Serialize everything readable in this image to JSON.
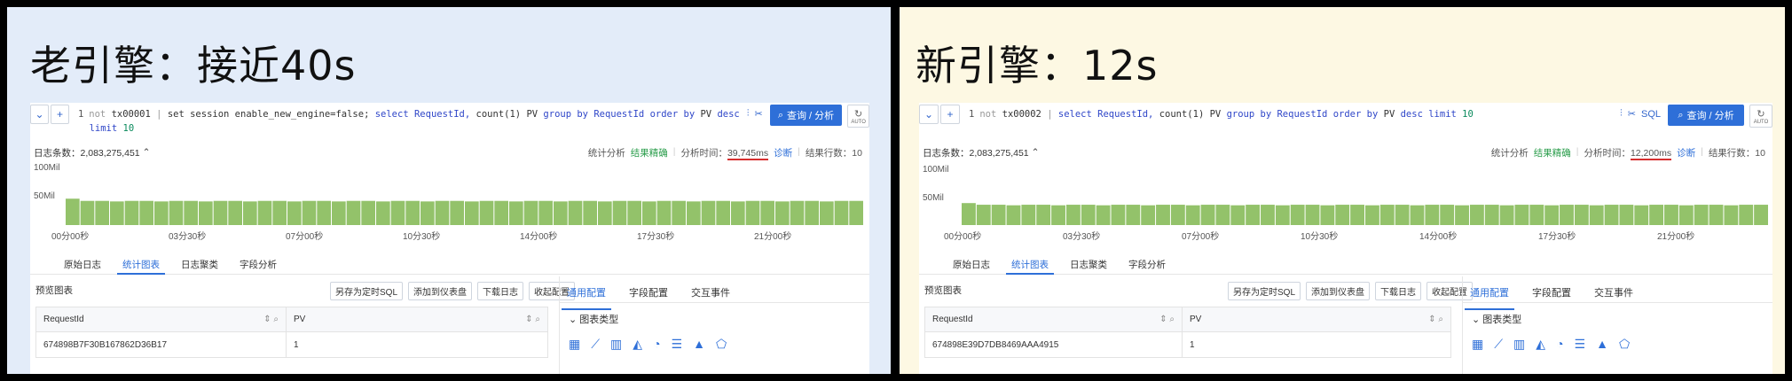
{
  "left": {
    "headline": "老引擎：接近40s",
    "query": {
      "line_number": "1",
      "not_label": "not",
      "tx_id": "tx00001",
      "pipe": "|",
      "set_stmt": "set session enable_new_engine=false;",
      "select_kw": "select",
      "col1": "RequestId,",
      "count_fn": "count(1)",
      "pv_as": "PV",
      "group_kw": "group by",
      "group_col": "RequestId",
      "order_kw": "order by",
      "order_col": "PV",
      "desc_kw": "desc",
      "limit_kw": "limit",
      "limit_val": "10",
      "search_label": "查询 / 分析",
      "auto_label": "AUTO"
    },
    "stats": {
      "log_count_label": "日志条数：2,083,275,451",
      "stat_analysis": "统计分析",
      "result_exact": "结果精确",
      "time_label": "分析时间：",
      "time_value": "39,745ms",
      "diagnose": "诊断",
      "rows_label": "结果行数：10"
    },
    "histogram": {
      "y_top": "100Mil",
      "y_mid": "50Mil",
      "x_labels": [
        "00分00秒",
        "03分30秒",
        "07分00秒",
        "10分30秒",
        "14分00秒",
        "17分30秒",
        "21分00秒"
      ]
    },
    "tabs": [
      "原始日志",
      "统计图表",
      "日志聚类",
      "字段分析"
    ],
    "preview_title": "预览图表",
    "actions": [
      "另存为定时SQL",
      "添加到仪表盘",
      "下载日志",
      "收起配置"
    ],
    "table": {
      "headers": [
        "RequestId",
        "PV"
      ],
      "rows": [
        [
          "674898B7F30B167862D36B17",
          "1"
        ]
      ]
    },
    "side_tabs": [
      "通用配置",
      "字段配置",
      "交互事件"
    ],
    "chart_type_label": "图表类型"
  },
  "right": {
    "headline": "新引擎：12s",
    "query": {
      "line_number": "1",
      "not_label": "not",
      "tx_id": "tx00002",
      "pipe": "|",
      "select_kw": "select",
      "col1": "RequestId,",
      "count_fn": "count(1)",
      "pv_as": "PV",
      "group_kw": "group by",
      "group_col": "RequestId",
      "order_kw": "order by",
      "order_col": "PV",
      "desc_kw": "desc",
      "limit_kw": "limit",
      "limit_val": "10",
      "sql_label": "SQL",
      "search_label": "查询 / 分析",
      "auto_label": "AUTO"
    },
    "stats": {
      "log_count_label": "日志条数：2,083,275,451",
      "stat_analysis": "统计分析",
      "result_exact": "结果精确",
      "time_label": "分析时间：",
      "time_value": "12,200ms",
      "diagnose": "诊断",
      "rows_label": "结果行数：10"
    },
    "histogram": {
      "y_top": "100Mil",
      "y_mid": "50Mil",
      "x_labels": [
        "00分00秒",
        "03分30秒",
        "07分00秒",
        "10分30秒",
        "14分00秒",
        "17分30秒",
        "21分00秒"
      ]
    },
    "tabs": [
      "原始日志",
      "统计图表",
      "日志聚类",
      "字段分析"
    ],
    "preview_title": "预览图表",
    "actions": [
      "另存为定时SQL",
      "添加到仪表盘",
      "下载日志",
      "收起配置"
    ],
    "table": {
      "headers": [
        "RequestId",
        "PV"
      ],
      "rows": [
        [
          "674898E39D7DB8469AAA4915",
          "1"
        ]
      ]
    },
    "side_tabs": [
      "通用配置",
      "字段配置",
      "交互事件"
    ],
    "chart_type_label": "图表类型"
  },
  "colors": {
    "accent": "#2e6fd8",
    "bar": "#93c26a",
    "highlight": "#d62f2f",
    "left_bg": "#e3ecf9",
    "right_bg": "#fdf8e3"
  },
  "icons": [
    "chevron-down-icon",
    "plus-icon",
    "search-icon",
    "refresh-icon",
    "chart-type-icons"
  ],
  "chart_data": [
    {
      "type": "bar",
      "title": "",
      "ylim": [
        0,
        100
      ],
      "series": [
        {
          "values": [
            48,
            44,
            44,
            43,
            44,
            44,
            43,
            44,
            44,
            43,
            44,
            44,
            43,
            44,
            44,
            43,
            44,
            44,
            43,
            44,
            44,
            43,
            44,
            44,
            43,
            44,
            44,
            43,
            44,
            44,
            43,
            44,
            44,
            43,
            44,
            44,
            43,
            44,
            44,
            43,
            44,
            44,
            43,
            44,
            44,
            43,
            44,
            44,
            43,
            44,
            44,
            43,
            44,
            44
          ]
        }
      ]
    },
    {
      "type": "bar",
      "title": "",
      "ylim": [
        0,
        100
      ],
      "series": [
        {
          "values": [
            40,
            37,
            37,
            36,
            37,
            37,
            36,
            37,
            37,
            36,
            37,
            37,
            36,
            37,
            37,
            36,
            37,
            37,
            36,
            37,
            37,
            36,
            37,
            37,
            36,
            37,
            37,
            36,
            37,
            37,
            36,
            37,
            37,
            36,
            37,
            37,
            36,
            37,
            37,
            36,
            37,
            37,
            36,
            37,
            37,
            36,
            37,
            37,
            36,
            37,
            37,
            36,
            37,
            37
          ]
        }
      ]
    }
  ]
}
